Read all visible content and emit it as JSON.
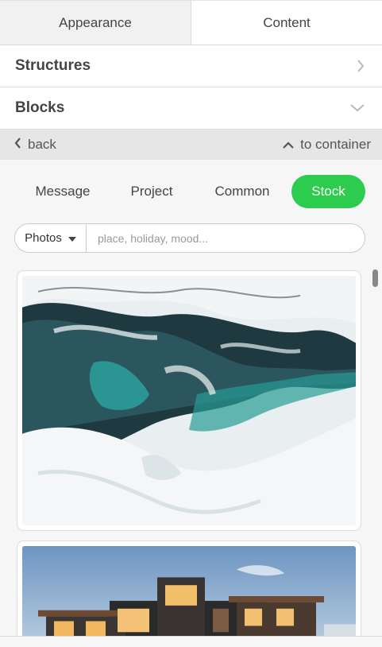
{
  "tabs": [
    {
      "label": "Appearance",
      "active": false
    },
    {
      "label": "Content",
      "active": true
    }
  ],
  "sections": {
    "structures": {
      "label": "Structures",
      "icon": "chevron-right-icon"
    },
    "blocks": {
      "label": "Blocks",
      "icon": "chevron-down-icon"
    }
  },
  "nav": {
    "back_label": "back",
    "container_label": "to container"
  },
  "source_tabs": [
    {
      "label": "Message",
      "active": false
    },
    {
      "label": "Project",
      "active": false
    },
    {
      "label": "Common",
      "active": false
    },
    {
      "label": "Stock",
      "active": true
    }
  ],
  "search": {
    "type_label": "Photos",
    "placeholder": "place, holiday, mood..."
  },
  "images": [
    {
      "name": "snowy-river-aerial-photo"
    },
    {
      "name": "modern-house-photo"
    }
  ],
  "colors": {
    "accent": "#2dcc4f",
    "nav_bar": "#e6e6e6"
  }
}
